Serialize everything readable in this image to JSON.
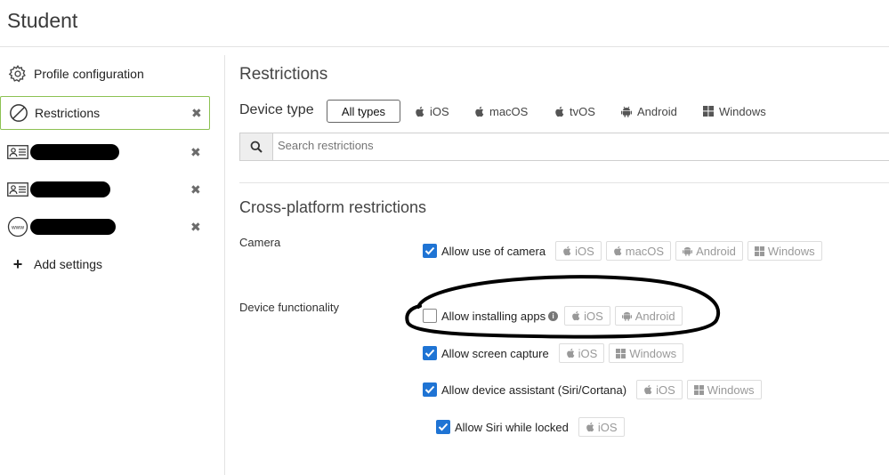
{
  "page": {
    "title": "Student"
  },
  "sidebar": {
    "items": [
      {
        "label": "Profile configuration",
        "icon": "gear-icon"
      },
      {
        "label": "Restrictions",
        "icon": "prohibit-icon",
        "active": true
      },
      {
        "label": "",
        "icon": "id-card-icon",
        "redacted": true
      },
      {
        "label": "",
        "icon": "id-card-icon",
        "redacted": true
      },
      {
        "label": "",
        "icon": "www-icon",
        "redacted": true
      }
    ],
    "add_label": "Add settings"
  },
  "main": {
    "title": "Restrictions",
    "device_type_label": "Device type",
    "device_types": [
      "All types",
      "iOS",
      "macOS",
      "tvOS",
      "Android",
      "Windows"
    ],
    "selected_device_type": "All types",
    "search_placeholder": "Search restrictions",
    "section_title": "Cross-platform restrictions",
    "groups": {
      "camera": {
        "label": "Camera",
        "options": [
          {
            "label": "Allow use of camera",
            "checked": true,
            "platforms": [
              "iOS",
              "macOS",
              "Android",
              "Windows"
            ]
          }
        ]
      },
      "device_functionality": {
        "label": "Device functionality",
        "options": [
          {
            "label": "Allow installing apps",
            "checked": false,
            "info": true,
            "platforms": [
              "iOS",
              "Android"
            ]
          },
          {
            "label": "Allow screen capture",
            "checked": true,
            "platforms": [
              "iOS",
              "Windows"
            ]
          },
          {
            "label": "Allow device assistant (Siri/Cortana)",
            "checked": true,
            "platforms": [
              "iOS",
              "Windows"
            ]
          },
          {
            "label": "Allow Siri while locked",
            "checked": true,
            "platforms": [
              "iOS"
            ]
          }
        ]
      }
    }
  },
  "colors": {
    "accent": "#1f74d4",
    "active_border": "#8cc152",
    "annotation": "#000000"
  }
}
